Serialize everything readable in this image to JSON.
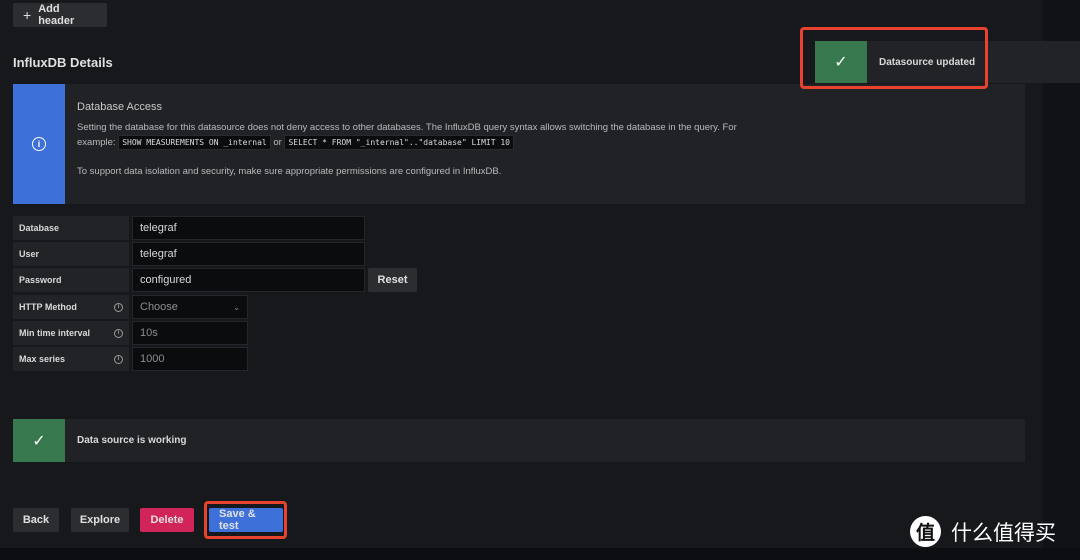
{
  "add_header": "Add header",
  "section_title": "InfluxDB Details",
  "info": {
    "title": "Database Access",
    "text1": "Setting the database for this datasource does not deny access to other databases. The InfluxDB query syntax allows switching the database in the query. For",
    "example_prefix": "example:",
    "code1": "SHOW MEASUREMENTS ON _internal",
    "or": "or",
    "code2": "SELECT * FROM \"_internal\"..\"database\" LIMIT 10",
    "text2": "To support data isolation and security, make sure appropriate permissions are configured in InfluxDB."
  },
  "fields": [
    {
      "label": "Database",
      "value": "telegraf"
    },
    {
      "label": "User",
      "value": "telegraf"
    },
    {
      "label": "Password",
      "value": "configured",
      "button": "Reset"
    },
    {
      "label": "HTTP Method",
      "value": "Choose"
    },
    {
      "label": "Min time interval",
      "value": "10s"
    },
    {
      "label": "Max series",
      "value": "1000"
    }
  ],
  "status": "Data source is working",
  "toast": "Datasource updated",
  "buttons": {
    "back": "Back",
    "explore": "Explore",
    "delete": "Delete",
    "save": "Save & test"
  },
  "watermark": "什么值得买",
  "colors": {
    "info": "#3d71d9",
    "success": "#37784f",
    "danger": "#d1255a",
    "primary": "#3d71d9",
    "highlight": "#e8432e"
  }
}
